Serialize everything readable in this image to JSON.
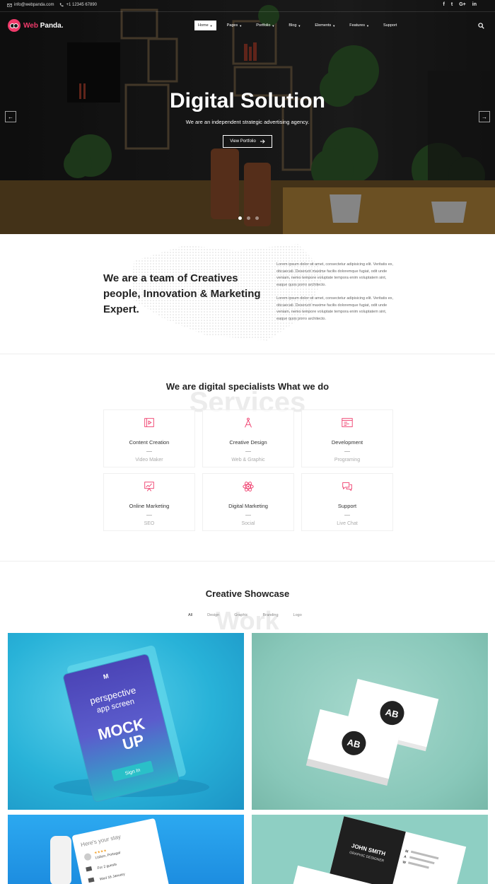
{
  "topbar": {
    "email": "info@webpanda.com",
    "phone": "+1 12345 67890",
    "social": [
      "f",
      "t",
      "G+",
      "in"
    ]
  },
  "brand": {
    "name_prefix": "Web",
    "name_suffix": " Panda.",
    "accent": "#ef3a6a"
  },
  "nav": {
    "items": [
      {
        "label": "Home",
        "caret": true,
        "active": true
      },
      {
        "label": "Pages",
        "caret": true
      },
      {
        "label": "Portfolio",
        "caret": true
      },
      {
        "label": "Blog",
        "caret": true
      },
      {
        "label": "Elements",
        "caret": true
      },
      {
        "label": "Features",
        "caret": true
      },
      {
        "label": "Support",
        "caret": false
      }
    ]
  },
  "hero": {
    "title": "Digital Solution",
    "subtitle": "We are an independent strategic advertising agency.",
    "button_label": "View Portfolio",
    "prev_label": "←",
    "next_label": "→",
    "slides": 3,
    "active_slide": 1
  },
  "about": {
    "title": "We are a team of Creatives people, Innovation & Marketing Expert.",
    "paragraph_1": "Lorem ipsum dolor sit amet, consectetur adipisicing elit. Veritatis ex, obcaecati. Deserunt maxime facilis doloremque fugiat, odit unde veniam, nemo tempore voluptate tempora enim voluptatem sint, eaque quos porro architecto.",
    "paragraph_2": "Lorem ipsum dolor sit amet, consectetur adipisicing elit. Veritatis ex, obcaecati. Deserunt maxime facilis doloremque fugiat, odit unde veniam, nemo tempore voluptate tempora enim voluptatem sint, eaque quos porro architecto."
  },
  "services": {
    "background_word": "Services",
    "heading": "We are digital specialists What we do",
    "items": [
      {
        "name": "Content Creation",
        "sub": "Video Maker",
        "icon": "video-icon"
      },
      {
        "name": "Creative Design",
        "sub": "Web & Graphic",
        "icon": "compass-icon"
      },
      {
        "name": "Development",
        "sub": "Programing",
        "icon": "browser-code-icon"
      },
      {
        "name": "Online Marketing",
        "sub": "SEO",
        "icon": "chart-board-icon"
      },
      {
        "name": "Digital Marketing",
        "sub": "Social",
        "icon": "atom-icon"
      },
      {
        "name": "Support",
        "sub": "Live Chat",
        "icon": "chat-icon"
      }
    ]
  },
  "work": {
    "background_word": "Work",
    "heading": "Creative Showcase",
    "filters": [
      "All",
      "Design",
      "Graphic",
      "Branding",
      "Logo"
    ],
    "active_filter": "All",
    "tiles": [
      {
        "top_label": "perspective",
        "sub_label": "app screen",
        "big_1": "MOCK",
        "big_2": "UP",
        "button": "Sign In"
      },
      {
        "logo": "AB"
      },
      {
        "text": "Here's your stay",
        "line_1": "Lisbon, Portugal",
        "line_2": "For 2 guests",
        "line_3": "Wed 16 January"
      },
      {
        "name": "JOHN SMITH",
        "role": "GRAPHIC DESIGNER",
        "m": "M",
        "a": "A",
        "w": "W"
      }
    ]
  }
}
